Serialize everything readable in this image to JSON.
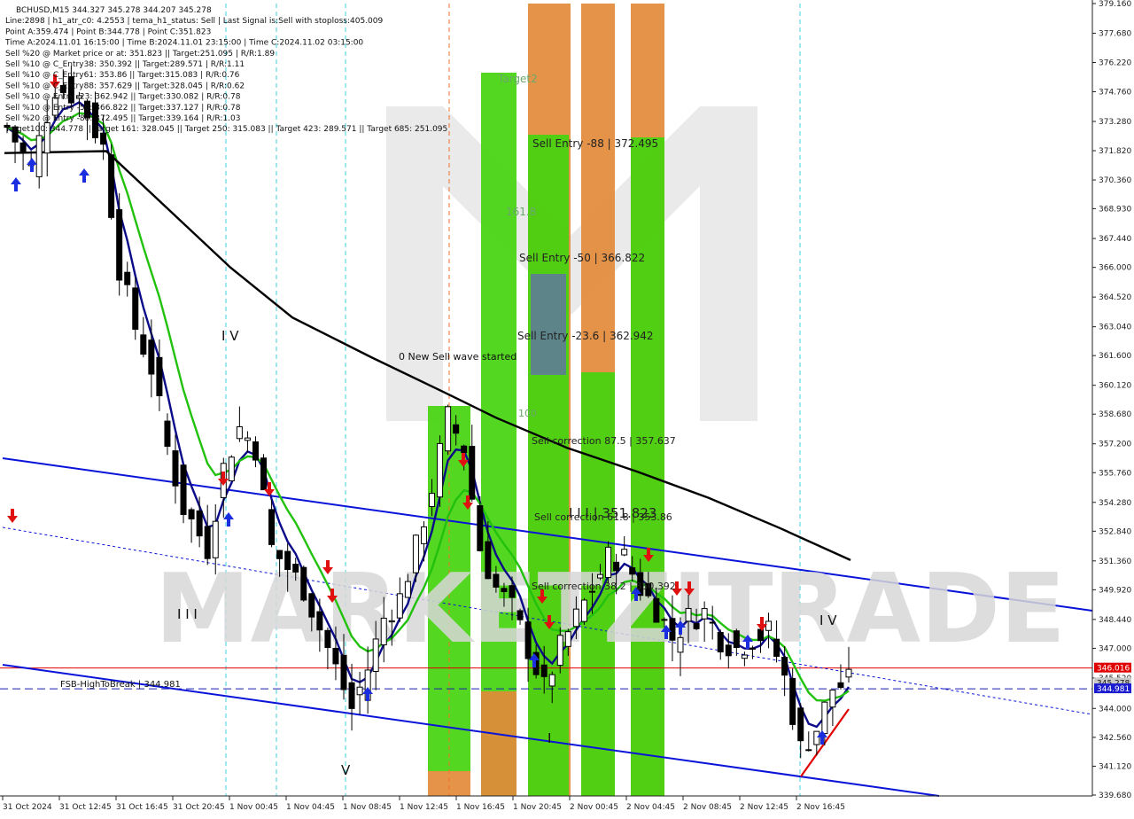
{
  "header_lines": [
    "BCHUSD,M15  344.327 345.278 344.207 345.278",
    "Line:2898 | h1_atr_c0: 4.2553 | tema_h1_status: Sell | Last Signal is:Sell with stoploss:405.009",
    "Point A:359.474 | Point B:344.778 | Point C:351.823",
    "Time A:2024.11.01 16:15:00 | Time B:2024.11.01 23:15:00 | Time C:2024.11.02 03:15:00",
    "Sell %20 @ Market price or at: 351.823 || Target:251.095 | R/R:1.89",
    "Sell %10 @ C_Entry38: 350.392 || Target:289.571 | R/R:1.11",
    "Sell %10 @ C_Entry61: 353.86 || Target:315.083 | R/R:0.76",
    "Sell %10 @ C_Entry88: 357.629 || Target:328.045 | R/R:0.62",
    "Sell %10 @ Entry -23: 362.942 || Target:330.082 | R/R:0.78",
    "Sell %10 @ Entry -50: 366.822 || Target:337.127 | R/R:0.78",
    "Sell %20 @ Entry -88: 372.495 || Target:339.164 | R/R:1.03",
    "Target100: 344.778 || Target 161: 328.045 || Target 250: 315.083 || Target 423: 289.571 || Target 685: 251.095"
  ],
  "watermark": "MARKETZITRADE",
  "annotations": {
    "target2": "Target2",
    "sell_entry_88": "Sell Entry -88 | 372.495",
    "fib_161": "161.8",
    "sell_entry_50": "Sell Entry -50 | 366.822",
    "sell_entry_23": "Sell Entry -23.6 | 362.942",
    "new_wave": "0 New Sell wave started",
    "fib_100": "100",
    "sell_corr_87": "Sell correction 87.5 | 357.637",
    "sell_corr_61": "Sell correction 61.8 | 353.86",
    "point_c": "I I I | 351.823",
    "sell_corr_38": "Sell correction 38.2 | 350.392",
    "fsb": "FSB-HighToBreak | 344.981",
    "wave_iv_1": "I V",
    "wave_iii": "I I I",
    "wave_v": "V",
    "wave_i": "I",
    "wave_iv_2": "I V"
  },
  "price_tags": {
    "red": "346.016",
    "gray": "345.278",
    "blue": "344.981"
  },
  "colors": {
    "background": "#ffffff",
    "candle": "#000000",
    "ema_fast": "#0b0b8a",
    "ema_mid": "#22c10e",
    "ema_slow": "#000000",
    "channel": "#0a14d8",
    "zone_green": "#44d40e",
    "zone_orange": "#e28a3a",
    "zone_steel": "#5e7f90",
    "red_line": "#e00000",
    "cyan_grid": "#3dd3e0",
    "orange_line": "#f07030"
  },
  "chart_data": {
    "type": "candlestick",
    "symbol": "BCHUSD",
    "timeframe": "M15",
    "last_ohlc": {
      "open": 344.327,
      "high": 345.278,
      "low": 344.207,
      "close": 345.278
    },
    "ylim": [
      339.68,
      379.16
    ],
    "y_ticks": [
      "379.160",
      "377.680",
      "376.220",
      "374.760",
      "373.280",
      "371.820",
      "370.360",
      "368.930",
      "367.440",
      "366.000",
      "364.520",
      "363.040",
      "361.600",
      "360.120",
      "358.680",
      "357.200",
      "355.760",
      "354.280",
      "352.840",
      "351.360",
      "349.920",
      "348.440",
      "347.000",
      "345.520",
      "344.000",
      "342.560",
      "341.120",
      "339.680"
    ],
    "x_ticks": [
      "31 Oct 2024",
      "31 Oct 12:45",
      "31 Oct 16:45",
      "31 Oct 20:45",
      "1 Nov 00:45",
      "1 Nov 04:45",
      "1 Nov 08:45",
      "1 Nov 12:45",
      "1 Nov 16:45",
      "1 Nov 20:45",
      "2 Nov 00:45",
      "2 Nov 04:45",
      "2 Nov 08:45",
      "2 Nov 12:45",
      "2 Nov 16:45"
    ],
    "levels": {
      "sell_entry_88": 372.495,
      "sell_entry_50": 366.822,
      "sell_entry_23_6": 362.942,
      "sell_correction_87_5": 357.637,
      "sell_correction_61_8": 353.86,
      "sell_correction_38_2": 350.392,
      "point_c": 351.823,
      "fsb_high_to_break": 344.981,
      "red_line": 346.016,
      "current": 345.278
    },
    "close_path": [
      [
        0,
        373
      ],
      [
        3,
        371
      ],
      [
        6,
        375
      ],
      [
        9,
        374.5
      ],
      [
        12,
        372
      ],
      [
        14,
        366
      ],
      [
        16,
        363
      ],
      [
        18,
        361
      ],
      [
        20,
        357
      ],
      [
        22,
        354
      ],
      [
        25,
        352
      ],
      [
        27,
        356
      ],
      [
        29,
        358
      ],
      [
        31,
        357
      ],
      [
        33,
        352
      ],
      [
        35,
        351
      ],
      [
        37,
        350
      ],
      [
        39,
        348
      ],
      [
        41,
        346
      ],
      [
        43,
        344
      ],
      [
        45,
        346
      ],
      [
        47,
        348.5
      ],
      [
        49,
        349.5
      ],
      [
        51,
        352
      ],
      [
        53,
        355
      ],
      [
        55,
        358.5
      ],
      [
        57,
        357
      ],
      [
        59,
        352
      ],
      [
        61,
        350
      ],
      [
        63,
        349
      ],
      [
        65,
        347
      ],
      [
        67,
        345
      ],
      [
        69,
        347
      ],
      [
        71,
        348.5
      ],
      [
        73,
        350
      ],
      [
        75,
        351.5
      ],
      [
        77,
        351.5
      ],
      [
        79,
        350
      ],
      [
        81,
        349
      ],
      [
        83,
        347.5
      ],
      [
        85,
        348.5
      ],
      [
        87,
        348.8
      ],
      [
        89,
        347.5
      ],
      [
        91,
        347
      ],
      [
        93,
        347.5
      ],
      [
        95,
        347.8
      ],
      [
        97,
        345.5
      ],
      [
        99,
        342
      ],
      [
        101,
        343
      ],
      [
        103,
        345
      ],
      [
        105,
        345.3
      ]
    ]
  }
}
